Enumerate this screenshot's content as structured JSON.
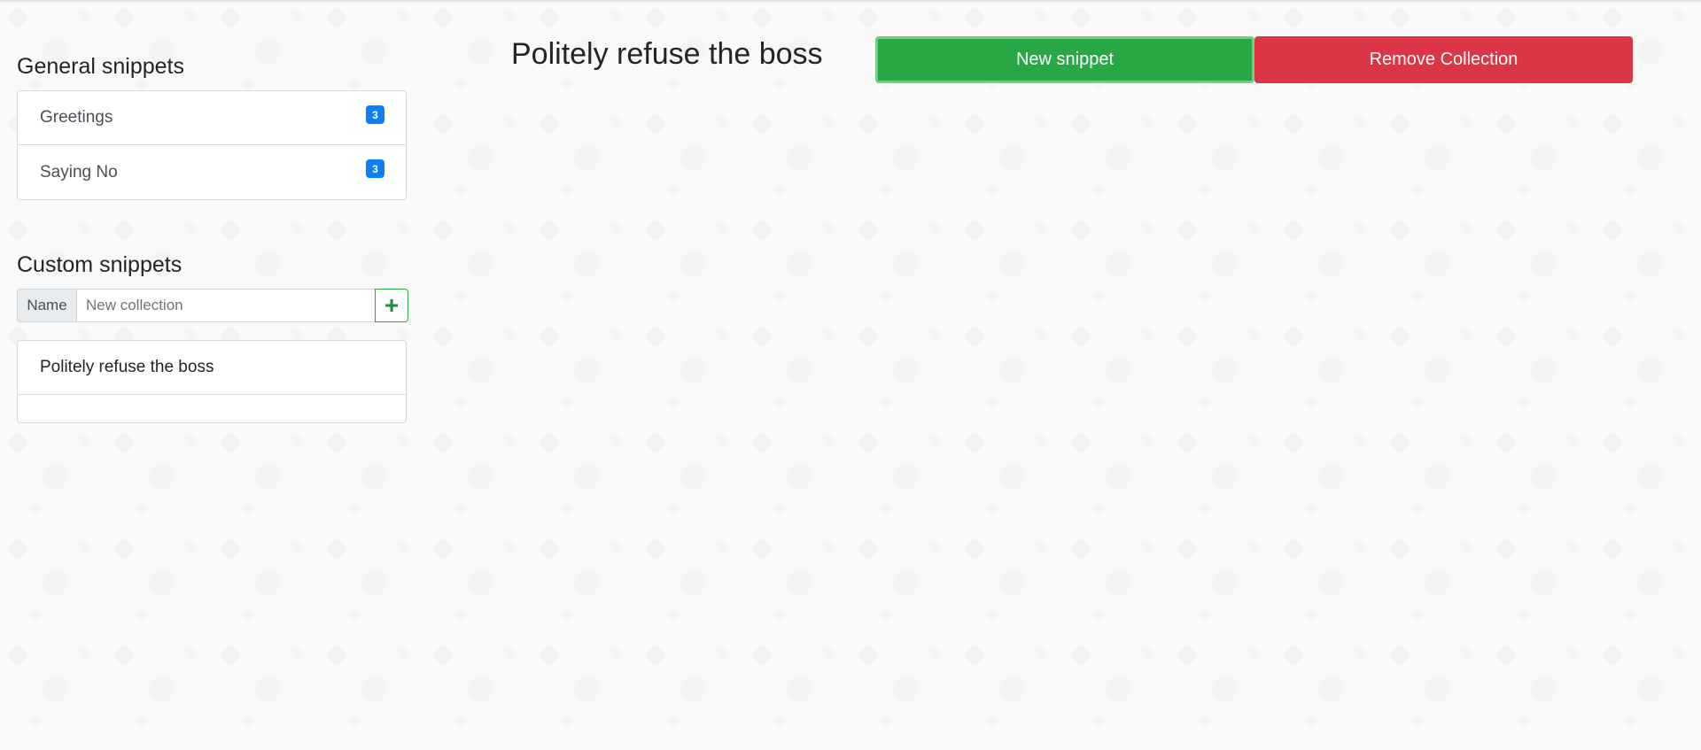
{
  "sidebar": {
    "general_heading": "General snippets",
    "general_items": [
      {
        "label": "Greetings",
        "count": "3"
      },
      {
        "label": "Saying No",
        "count": "3"
      }
    ],
    "custom_heading": "Custom snippets",
    "new_collection": {
      "prefix": "Name",
      "placeholder": "New collection",
      "value": "",
      "add_icon": "plus-icon",
      "add_symbol": "+"
    },
    "custom_items": [
      {
        "label": "Politely refuse the boss"
      }
    ]
  },
  "main": {
    "title": "Politely refuse the boss",
    "new_snippet_label": "New snippet",
    "remove_collection_label": "Remove Collection"
  },
  "colors": {
    "success": "#28a745",
    "danger": "#dc3545",
    "badge": "#0d7ef3",
    "background": "#f9f9f9"
  }
}
